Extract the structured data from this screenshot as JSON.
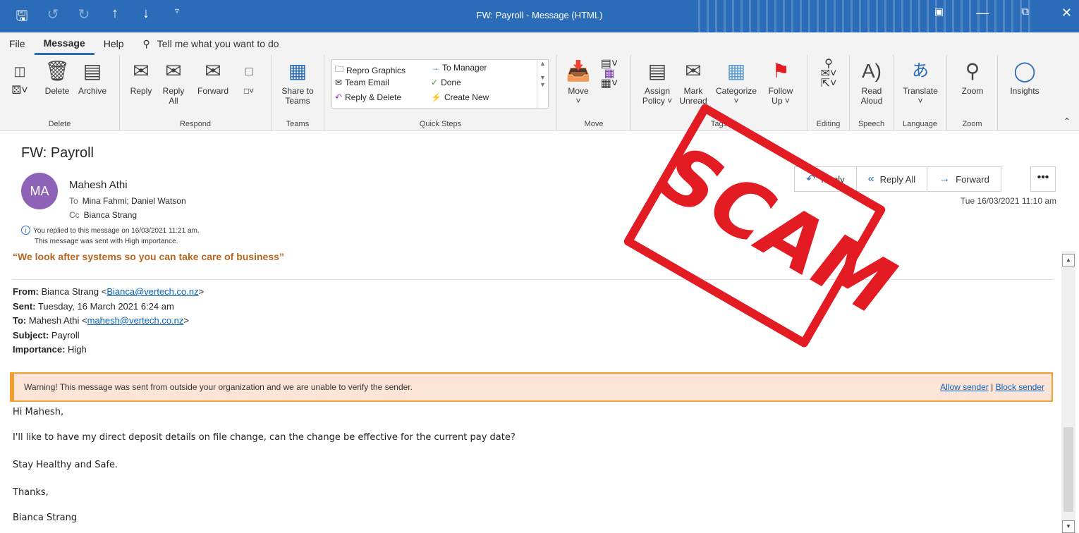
{
  "window": {
    "title": "FW: Payroll  -  Message (HTML)",
    "qat": [
      "save-icon",
      "undo-icon",
      "redo-icon",
      "up-arrow-icon",
      "down-arrow-icon",
      "customize-icon"
    ]
  },
  "menu": {
    "tabs": [
      "File",
      "Message",
      "Help"
    ],
    "active": "Message",
    "tell_me": "Tell me what you want to do"
  },
  "ribbon": {
    "delete": {
      "group": "Delete",
      "delete": "Delete",
      "archive": "Archive"
    },
    "respond": {
      "group": "Respond",
      "reply": "Reply",
      "reply_all_1": "Reply",
      "reply_all_2": "All",
      "forward": "Forward"
    },
    "teams": {
      "group": "Teams",
      "share_1": "Share to",
      "share_2": "Teams"
    },
    "quick_steps": {
      "group": "Quick Steps",
      "items": [
        "Repro Graphics",
        "To Manager",
        "Team Email",
        "Done",
        "Reply & Delete",
        "Create New"
      ]
    },
    "move": {
      "group": "Move",
      "move": "Move"
    },
    "tags": {
      "group": "Tags",
      "assign_1": "Assign",
      "assign_2": "Policy ˅",
      "mark_1": "Mark",
      "mark_2": "Unread",
      "categorize": "Categorize",
      "follow_1": "Follow",
      "follow_2": "Up ˅"
    },
    "editing": {
      "group": "Editing"
    },
    "speech": {
      "group": "Speech",
      "read_1": "Read",
      "read_2": "Aloud"
    },
    "language": {
      "group": "Language",
      "translate": "Translate"
    },
    "zoom": {
      "group": "Zoom",
      "zoom": "Zoom"
    },
    "insights": {
      "label": "Insights"
    }
  },
  "message": {
    "subject": "FW: Payroll",
    "avatar_initials": "MA",
    "sender": "Mahesh Athi",
    "to_label": "To",
    "to": "Mina Fahmi; Daniel Watson",
    "cc_label": "Cc",
    "cc": "Bianca Strang",
    "info_replied": "You replied to this message on 16/03/2021 11:21 am.",
    "info_importance": "This message was sent with High importance.",
    "date": "Tue 16/03/2021 11:10 am",
    "actions": {
      "reply": "Reply",
      "reply_all": "Reply All",
      "forward": "Forward",
      "more": "•••"
    }
  },
  "body": {
    "tagline": "“We look after systems so you can take care of business”",
    "from_label": "From:",
    "from_name": " Bianca Strang <",
    "from_email": "Bianca@vertech.co.nz",
    "close": ">",
    "sent_label": "Sent:",
    "sent": " Tuesday, 16 March 2021 6:24 am",
    "to_label": "To:",
    "to_name": " Mahesh Athi <",
    "to_email": "mahesh@vertech.co.nz",
    "subject_label": "Subject:",
    "subject": " Payroll",
    "importance_label": "Importance:",
    "importance": " High",
    "warning": "Warning! This message was sent from outside your organization and we are unable to verify the sender.",
    "allow": "Allow sender",
    "sep": " | ",
    "block": "Block sender",
    "greeting": "Hi Mahesh,",
    "line1": "I'll like to have my direct deposit details on file change, can the change be effective for the current pay date?",
    "line2": "Stay Healthy and Safe.",
    "line3": "Thanks,",
    "signature": "Bianca Strang"
  },
  "stamp": {
    "text": "SCAM",
    "color": "#e31b23"
  },
  "colors": {
    "accent": "#2b6cb8",
    "avatar": "#8e62b6",
    "tagline": "#b8651e",
    "warning_border": "#f0a030"
  }
}
